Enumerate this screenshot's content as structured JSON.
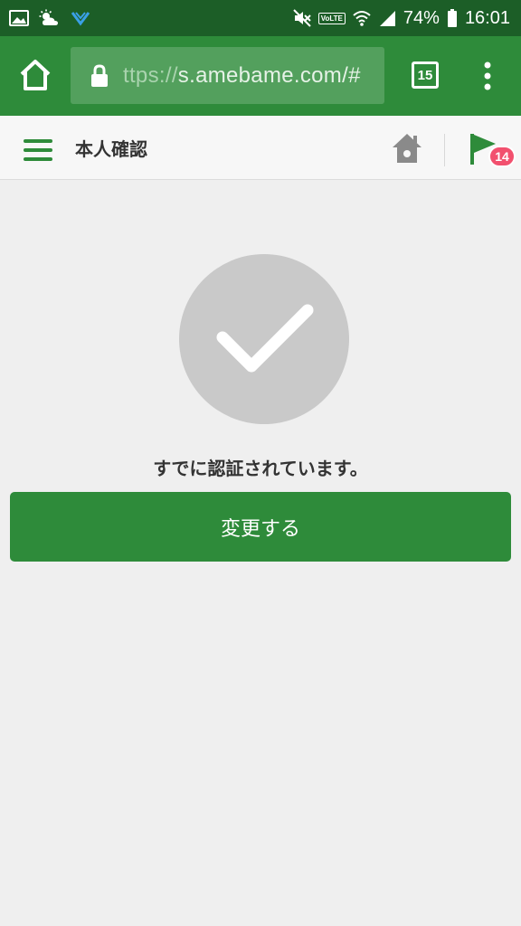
{
  "status_bar": {
    "battery": "74%",
    "time": "16:01",
    "volte": "VoLTE",
    "icons": [
      "image-icon",
      "weather-icon",
      "app-icon",
      "mute-icon",
      "wifi-icon",
      "signal-icon",
      "battery-icon"
    ]
  },
  "browser": {
    "url_scheme": "ttps://",
    "url_rest": "s.amebame.com/#",
    "tab_count": "15"
  },
  "header": {
    "title": "本人確認",
    "notification_count": "14"
  },
  "main": {
    "message": "すでに認証されています。",
    "change_button_label": "変更する"
  },
  "colors": {
    "status_bar": "#1c5e27",
    "brand_green": "#2e8b3a",
    "badge": "#f2506e",
    "check_circle": "#c9c9c9"
  }
}
